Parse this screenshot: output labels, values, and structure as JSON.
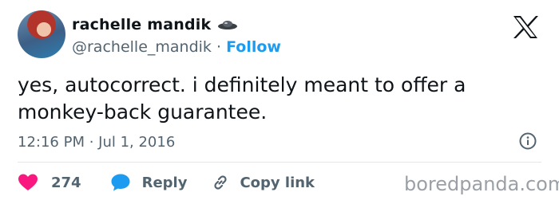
{
  "tweet": {
    "author_name": "rachelle mandik",
    "handle": "@rachelle_mandik",
    "separator": "·",
    "follow_label": "Follow",
    "text_line1": "yes, autocorrect. i definitely meant to offer a",
    "text_line2": "monkey-back guarantee.",
    "timestamp": "12:16 PM · Jul 1, 2016"
  },
  "actions": {
    "likes_count": "274",
    "reply_label": "Reply",
    "copy_link_label": "Copy link"
  },
  "watermark": "boredpanda.com",
  "colors": {
    "accent": "#1d9bf0",
    "like": "#f91880",
    "text": "#0f1419",
    "muted": "#536471"
  },
  "icons": [
    "x-logo-icon",
    "flying-saucer-icon",
    "info-icon",
    "heart-icon",
    "reply-bubble-icon",
    "link-icon"
  ]
}
